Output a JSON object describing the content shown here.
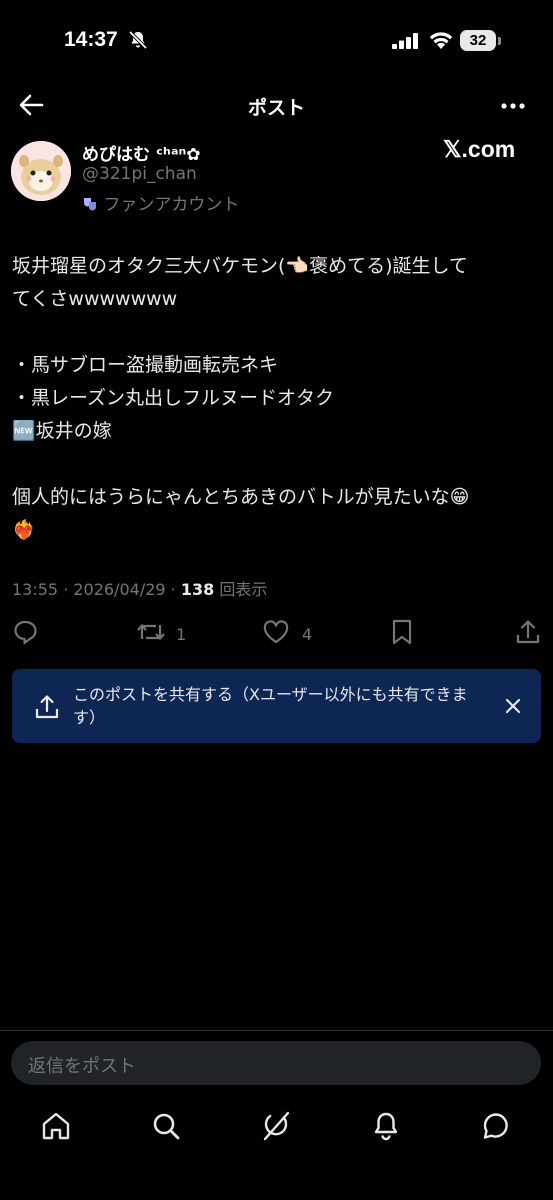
{
  "status_bar": {
    "time": "14:37",
    "battery": "32"
  },
  "header": {
    "title": "ポスト"
  },
  "author": {
    "name": "めぴはむ ᶜʰᵃⁿ✿",
    "handle": "@321pi_chan",
    "badge_label": "ファンアカウント",
    "badge_icon": "drama-masks-icon",
    "source_watermark": "𝕏.com"
  },
  "post": {
    "lines": [
      "坂井瑠星のオタク三大バケモン(👈🏻褒めてる)誕生して",
      "てくさwwwwwww",
      "",
      "・馬サブロー盗撮動画転売ネキ",
      "・黒レーズン丸出しフルヌードオタク",
      "🆕坂井の嫁",
      "",
      "個人的にはうらにゃんとちあきのバトルが見たいな😁",
      "❤️‍🔥"
    ],
    "timestamp": "13:55 · 2026/04/29 · ",
    "views_count": "138",
    "views_label": "回表示"
  },
  "actions": {
    "reply_count": "",
    "repost_count": "1",
    "like_count": "4"
  },
  "share_toast": {
    "text": "このポストを共有する（Xユーザー以外にも共有できます）"
  },
  "reply_bar": {
    "placeholder": "返信をポスト"
  },
  "colors": {
    "background": "#000000",
    "secondary_text": "#71767b",
    "toast_bg": "#0e2654"
  }
}
